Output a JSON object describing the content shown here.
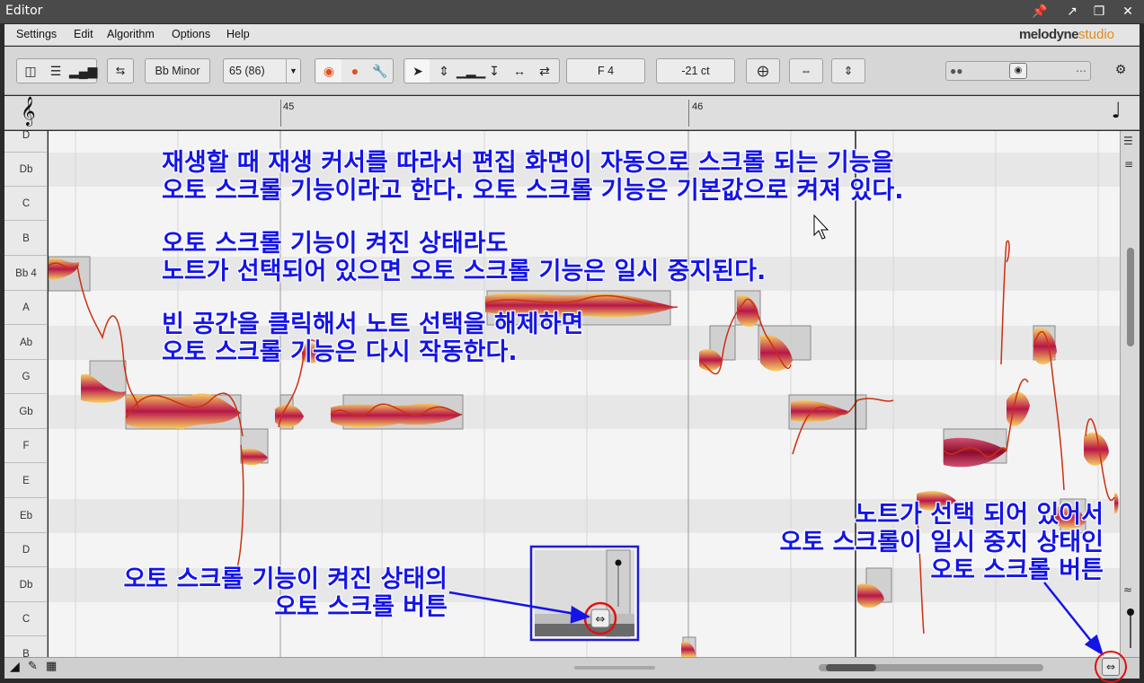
{
  "window": {
    "title": "Editor",
    "controls": [
      "pin-icon",
      "undock-icon",
      "maximize-icon",
      "close-icon"
    ]
  },
  "menu": {
    "items": [
      "Settings",
      "Edit",
      "Algorithm",
      "Options",
      "Help"
    ],
    "brand_main": "melodyne",
    "brand_sub": "studio"
  },
  "toolbar": {
    "key": "Bb Minor",
    "tempo": "65 (86)",
    "pitch_display": "F 4",
    "cents_display": "-21 ct"
  },
  "ruler": {
    "bars": [
      "45",
      "46"
    ]
  },
  "pitch_ruler": {
    "notes": [
      "D",
      "Db",
      "C",
      "B",
      "Bb 4",
      "A",
      "Ab",
      "G",
      "Gb",
      "F",
      "E",
      "Eb",
      "D",
      "Db",
      "C",
      "B"
    ]
  },
  "annotations": {
    "top": [
      "재생할 때 재생 커서를 따라서 편집 화면이 자동으로 스크롤 되는 기능을",
      "오토 스크롤 기능이라고 한다. 오토 스크롤 기능은 기본값으로 켜져 있다."
    ],
    "middle": [
      "오토 스크롤 기능이 켜진 상태라도",
      "노트가 선택되어 있으면 오토 스크롤 기능은 일시 중지된다."
    ],
    "lower": [
      "빈 공간을 클릭해서 노트 선택을 해제하면",
      "오토 스크롤 기능은 다시 작동한다."
    ],
    "left_callout": [
      "오토 스크롤 기능이 켜진 상태의",
      "오토 스크롤 버튼"
    ],
    "right_callout": [
      "노트가 선택 되어 있어서",
      "오토 스크롤이 일시 중지 상태인",
      "오토 스크롤 버튼"
    ]
  },
  "colors": {
    "annotation_text": "#1414e8",
    "annotation_outline": "#ffffff",
    "highlight_circle": "#e01010",
    "blob_core": "#b8164a",
    "blob_edge": "#f7d060"
  }
}
